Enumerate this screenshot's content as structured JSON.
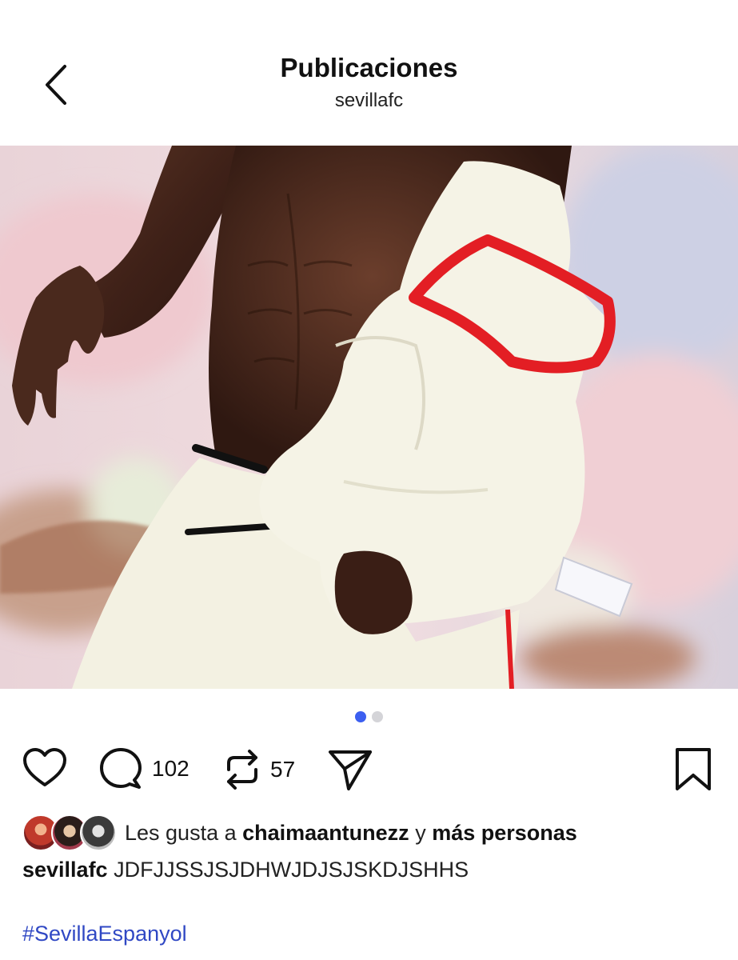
{
  "header": {
    "title": "Publicaciones",
    "subtitle": "sevillafc"
  },
  "pager": {
    "current": 1,
    "total": 2
  },
  "actions": {
    "comments_count": "102",
    "reposts_count": "57"
  },
  "likes": {
    "prefix": "Les gusta a",
    "user": "chaimaantunezz",
    "connector": "y",
    "others": "más personas"
  },
  "caption": {
    "username": "sevillafc",
    "text": "JDFJJSSJSJDHWJDJSJSKDJSHHS"
  },
  "hashtag": "#SevillaEspanyol",
  "colors": {
    "accent_blue": "#3c5ff0",
    "hashtag_blue": "#3048c4",
    "jersey_red": "#e31e24"
  }
}
